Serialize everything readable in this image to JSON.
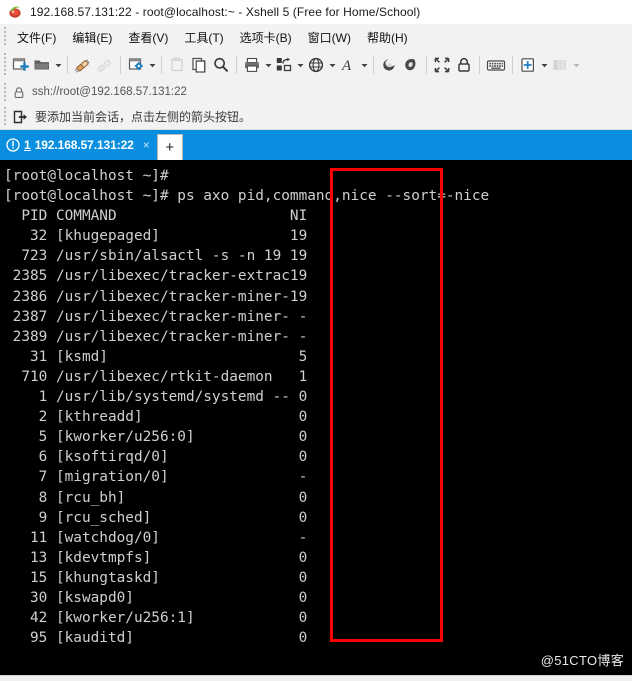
{
  "window": {
    "title": "192.168.57.131:22 - root@localhost:~ - Xshell 5 (Free for Home/School)",
    "app_icon": "xshell-logo-icon"
  },
  "menu": {
    "items": [
      {
        "label": "文件(F)",
        "name": "menu-file"
      },
      {
        "label": "编辑(E)",
        "name": "menu-edit"
      },
      {
        "label": "查看(V)",
        "name": "menu-view"
      },
      {
        "label": "工具(T)",
        "name": "menu-tools"
      },
      {
        "label": "选项卡(B)",
        "name": "menu-tabs"
      },
      {
        "label": "窗口(W)",
        "name": "menu-window"
      },
      {
        "label": "帮助(H)",
        "name": "menu-help"
      }
    ]
  },
  "toolbar": {
    "buttons": [
      {
        "name": "new-session-icon",
        "title": "新建会话"
      },
      {
        "name": "open-folder-icon",
        "title": "打开"
      },
      {
        "name": "connect-icon",
        "title": "连接"
      },
      {
        "name": "disconnect-icon",
        "title": "断开"
      },
      {
        "name": "session-properties-icon",
        "title": "属性"
      },
      {
        "name": "paste-clipboard-icon",
        "title": "粘贴"
      },
      {
        "name": "copy-icon",
        "title": "复制"
      },
      {
        "name": "find-icon",
        "title": "查找"
      },
      {
        "name": "print-icon",
        "title": "打印"
      },
      {
        "name": "file-transfer-icon",
        "title": "传输"
      },
      {
        "name": "globe-icon",
        "title": "网络"
      },
      {
        "name": "font-icon",
        "title": "字体"
      },
      {
        "name": "xftp-icon",
        "title": "Xftp"
      },
      {
        "name": "xagent-icon",
        "title": "Xagent"
      },
      {
        "name": "fullscreen-icon",
        "title": "全屏"
      },
      {
        "name": "lock-icon",
        "title": "锁定"
      },
      {
        "name": "keyboard-icon",
        "title": "键盘"
      },
      {
        "name": "add-note-icon",
        "title": "添加"
      },
      {
        "name": "layout-icon",
        "title": "布局"
      }
    ]
  },
  "address_bar": {
    "icon": "lock-icon",
    "value": "ssh://root@192.168.57.131:22"
  },
  "hint_bar": {
    "icon": "arrow-add-session-icon",
    "text": "要添加当前会话，点击左侧的箭头按钮。"
  },
  "tabs": {
    "active": {
      "warn_icon": "warning-circle-icon",
      "number": "1",
      "label": "192.168.57.131:22",
      "close": "×"
    },
    "new_tab_label": "+"
  },
  "terminal": {
    "prompt": "[root@localhost ~]#",
    "command": "ps axo pid,command,nice --sort=-nice",
    "header": {
      "pid": "PID",
      "command": "COMMAND",
      "ni": "NI"
    },
    "rows": [
      {
        "pid": "32",
        "command": "[khugepaged]",
        "ni": "19"
      },
      {
        "pid": "723",
        "command": "/usr/sbin/alsactl -s -n 19",
        "ni": "19"
      },
      {
        "pid": "2385",
        "command": "/usr/libexec/tracker-extrac",
        "ni": "19"
      },
      {
        "pid": "2386",
        "command": "/usr/libexec/tracker-miner-",
        "ni": "19"
      },
      {
        "pid": "2387",
        "command": "/usr/libexec/tracker-miner-",
        "ni": "-"
      },
      {
        "pid": "2389",
        "command": "/usr/libexec/tracker-miner-",
        "ni": "-"
      },
      {
        "pid": "31",
        "command": "[ksmd]",
        "ni": "5"
      },
      {
        "pid": "710",
        "command": "/usr/libexec/rtkit-daemon",
        "ni": "1"
      },
      {
        "pid": "1",
        "command": "/usr/lib/systemd/systemd --",
        "ni": "0"
      },
      {
        "pid": "2",
        "command": "[kthreadd]",
        "ni": "0"
      },
      {
        "pid": "5",
        "command": "[kworker/u256:0]",
        "ni": "0"
      },
      {
        "pid": "6",
        "command": "[ksoftirqd/0]",
        "ni": "0"
      },
      {
        "pid": "7",
        "command": "[migration/0]",
        "ni": "-"
      },
      {
        "pid": "8",
        "command": "[rcu_bh]",
        "ni": "0"
      },
      {
        "pid": "9",
        "command": "[rcu_sched]",
        "ni": "0"
      },
      {
        "pid": "11",
        "command": "[watchdog/0]",
        "ni": "-"
      },
      {
        "pid": "13",
        "command": "[kdevtmpfs]",
        "ni": "0"
      },
      {
        "pid": "15",
        "command": "[khungtaskd]",
        "ni": "0"
      },
      {
        "pid": "30",
        "command": "[kswapd0]",
        "ni": "0"
      },
      {
        "pid": "42",
        "command": "[kworker/u256:1]",
        "ni": "0"
      },
      {
        "pid": "95",
        "command": "[kauditd]",
        "ni": "0"
      }
    ]
  },
  "annotation": {
    "shape": "rectangle",
    "color": "#ff0000",
    "target": "NI column"
  },
  "watermark": {
    "text": "@51CTO博客"
  },
  "colors": {
    "accent": "#0a8fe0",
    "terminal_bg": "#000000",
    "terminal_fg": "#cfcfcf",
    "chrome_bg": "#f2f2f2",
    "annotation": "#ff0000"
  }
}
